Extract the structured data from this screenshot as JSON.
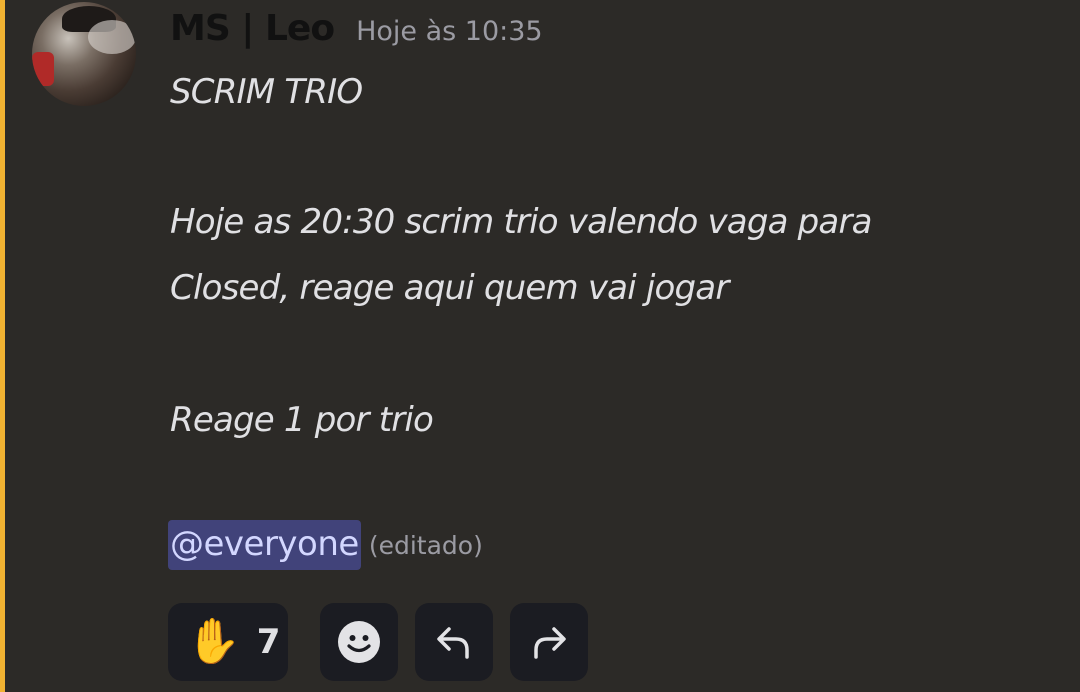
{
  "message": {
    "author": "MS | Leo",
    "timestamp": "Hoje às 10:35",
    "lines": [
      "SCRIM TRIO",
      "Hoje as 20:30 scrim trio valendo vaga para",
      "Closed, reage aqui quem vai jogar",
      "Reage 1 por trio"
    ],
    "mention": "@everyone",
    "edited_label": "(editado)"
  },
  "reactions": [
    {
      "emoji": "✋",
      "icon": "raised-hand-icon",
      "count": "7"
    }
  ],
  "actions": [
    {
      "icon": "add-reaction-icon"
    },
    {
      "icon": "reply-icon"
    },
    {
      "icon": "forward-icon"
    }
  ],
  "colors": {
    "accent": "#f0b232",
    "mention_bg": "#41437a",
    "mention_text": "#d3d7ff",
    "background": "#2c2a27",
    "button_bg": "#1b1c22"
  }
}
